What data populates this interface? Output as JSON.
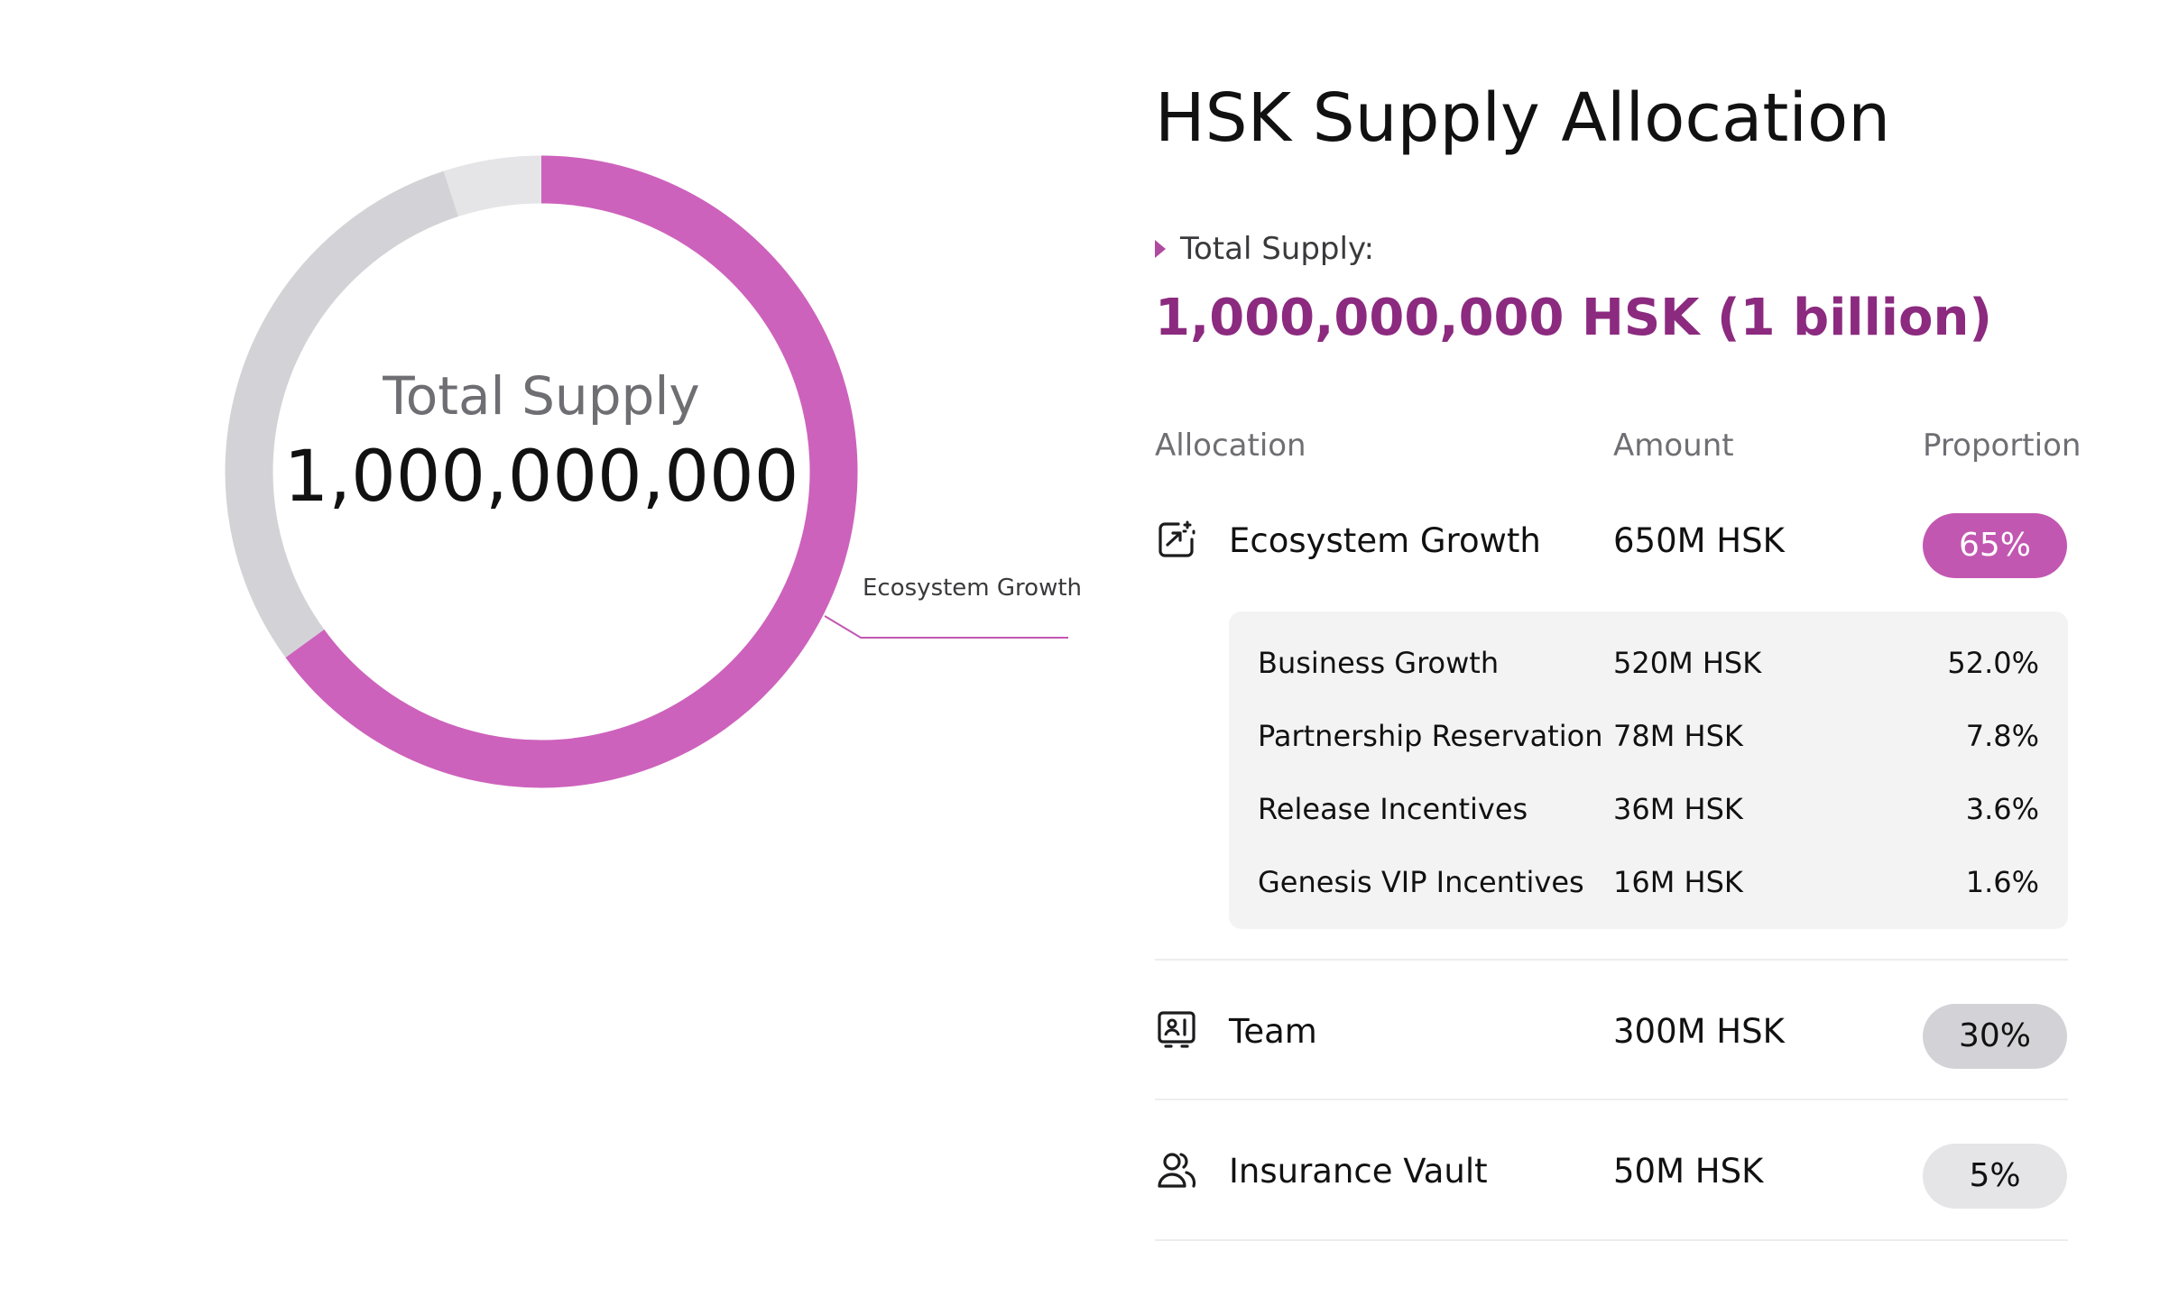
{
  "page": {
    "title": "HSK Supply Allocation",
    "total_supply_label": "Total Supply:",
    "total_supply_value": "1,000,000,000 HSK (1 billion)"
  },
  "donut_center": {
    "title": "Total Supply",
    "value": "1,000,000,000"
  },
  "chart_data": {
    "type": "pie",
    "categories": [
      "Ecosystem Growth",
      "Team",
      "Insurance Vault"
    ],
    "values": [
      65,
      30,
      5
    ],
    "colors": [
      "#cd62bc",
      "#d3d3d7",
      "#e5e5e8"
    ],
    "annotations": [
      {
        "text": "Ecosystem Growth",
        "target": "Ecosystem Growth"
      }
    ],
    "legend": "none",
    "style": "donut"
  },
  "table": {
    "headers": {
      "allocation": "Allocation",
      "amount": "Amount",
      "proportion": "Proportion"
    },
    "rows": [
      {
        "name": "Ecosystem Growth",
        "amount": "650M HSK",
        "proportion": "65%",
        "icon": "ecosystem-growth-icon",
        "pill_bg": "#c257b1",
        "pill_fg": "#ffffff"
      },
      {
        "name": "Team",
        "amount": "300M HSK",
        "proportion": "30%",
        "icon": "team-icon",
        "pill_bg": "#d3d3d7",
        "pill_fg": "#111111"
      },
      {
        "name": "Insurance Vault",
        "amount": "50M HSK",
        "proportion": "5%",
        "icon": "insurance-vault-icon",
        "pill_bg": "#e5e5e8",
        "pill_fg": "#111111"
      }
    ],
    "sub_rows": [
      {
        "name": "Business Growth",
        "amount": "520M HSK",
        "proportion": "52.0%"
      },
      {
        "name": "Partnership Reservation",
        "amount": "78M HSK",
        "proportion": "7.8%"
      },
      {
        "name": "Release Incentives",
        "amount": "36M HSK",
        "proportion": "3.6%"
      },
      {
        "name": "Genesis VIP Incentives",
        "amount": "16M HSK",
        "proportion": "1.6%"
      }
    ]
  }
}
